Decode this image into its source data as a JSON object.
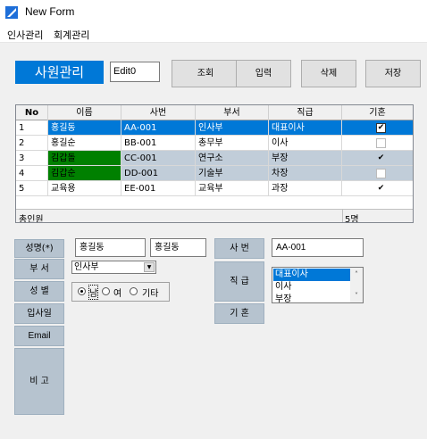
{
  "window": {
    "title": "New Form"
  },
  "menu": [
    "인사관리",
    "회계관리"
  ],
  "header": {
    "title": "사원관리",
    "edit0_value": "Edit0"
  },
  "buttons": {
    "search": "조회",
    "input": "입력",
    "delete": "삭제",
    "save": "저장"
  },
  "grid": {
    "columns": [
      "No",
      "이름",
      "사번",
      "부서",
      "직급",
      "기혼"
    ],
    "rows": [
      {
        "no": "1",
        "name": "홍길동",
        "id": "AA-001",
        "dept": "인사부",
        "rank": "대표이사",
        "married": true
      },
      {
        "no": "2",
        "name": "홍길순",
        "id": "BB-001",
        "dept": "총무부",
        "rank": "이사",
        "married": false
      },
      {
        "no": "3",
        "name": "김갑돌",
        "id": "CC-001",
        "dept": "연구소",
        "rank": "부장",
        "married": true
      },
      {
        "no": "4",
        "name": "김갑순",
        "id": "DD-001",
        "dept": "기술부",
        "rank": "차장",
        "married": false
      },
      {
        "no": "5",
        "name": "교육용",
        "id": "EE-001",
        "dept": "교육부",
        "rank": "과장",
        "married": true
      }
    ],
    "footer_label": "총인원",
    "footer_count": "5명",
    "colors": {
      "selected": "#0078d7",
      "alt_row": "#c1cdd9",
      "name_highlight": "#008000"
    }
  },
  "form": {
    "labels": {
      "name": "성명(*)",
      "dept": "부 서",
      "gender": "성 별",
      "join_date": "입사일",
      "email": "Email",
      "note": "비 고",
      "emp_no": "사 번",
      "rank": "직 급",
      "married": "기 혼"
    },
    "name_value": "홍길동",
    "name_value2": "홍길동",
    "dept_value": "인사부",
    "gender_options": [
      "남",
      "여",
      "기타"
    ],
    "gender_selected": "남",
    "emp_no_value": "AA-001",
    "rank_options": [
      "대표이사",
      "이사",
      "부장"
    ],
    "rank_selected": "대표이사"
  }
}
